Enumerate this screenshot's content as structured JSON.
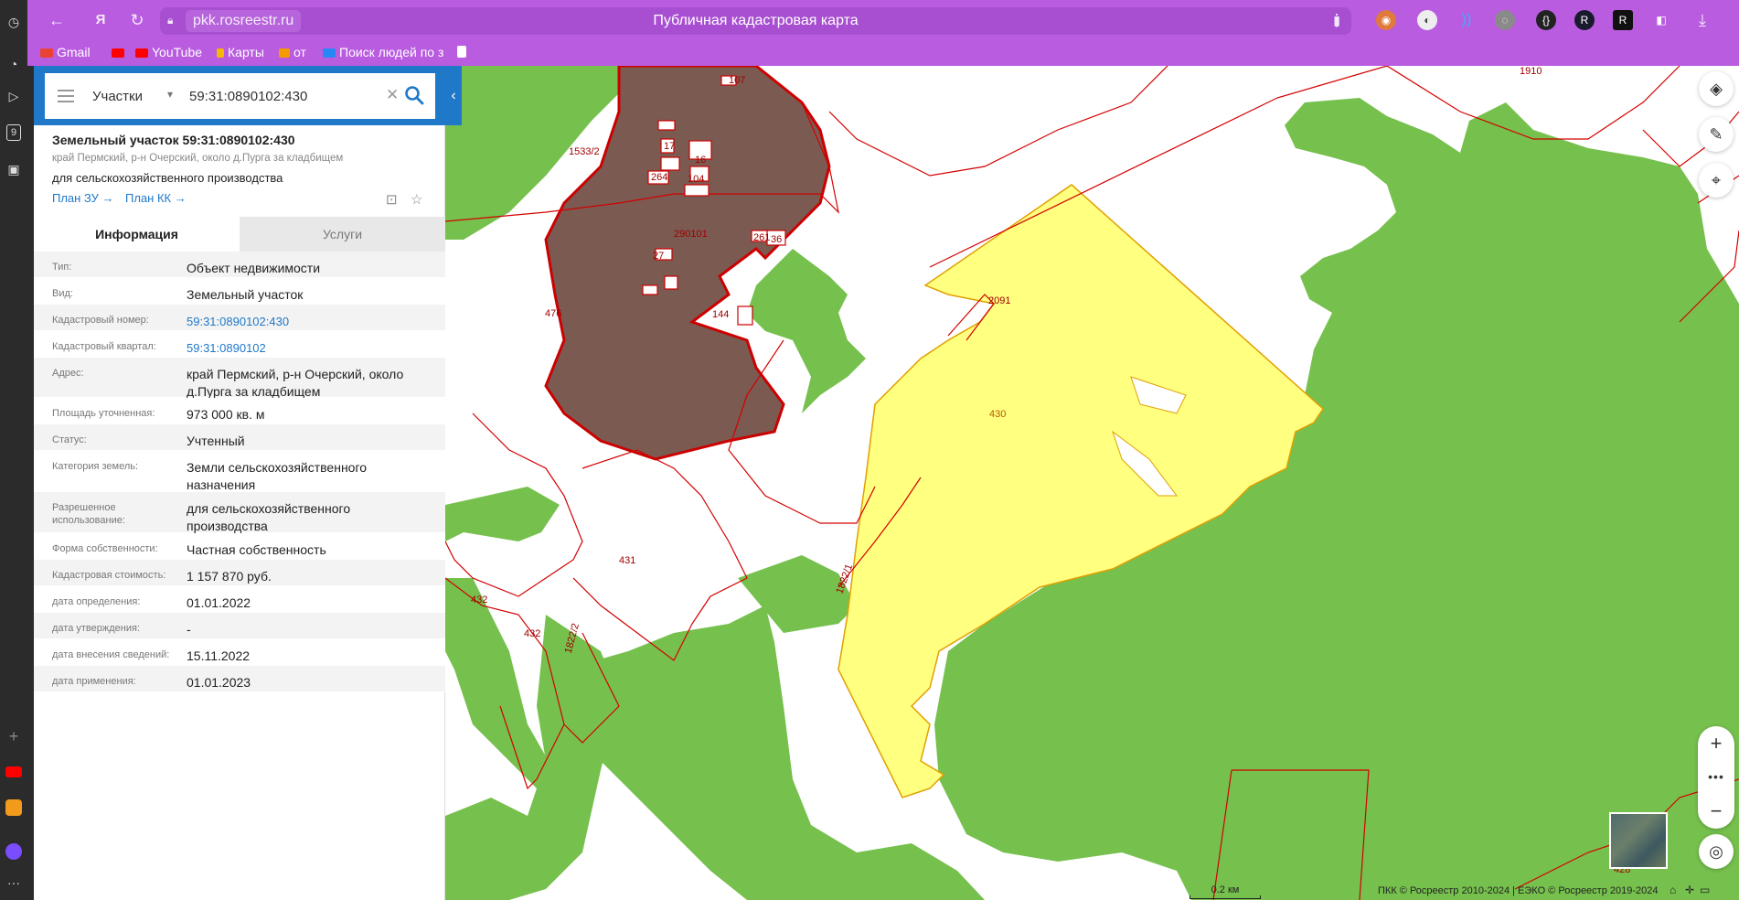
{
  "browser": {
    "url_domain": "pkk.rosreestr.ru",
    "page_title": "Публичная кадастровая карта",
    "bookmarks": [
      {
        "label": "Gmail",
        "color": "#ea4335"
      },
      {
        "label": "YouTube",
        "color": "#ff0000"
      },
      {
        "label": "Карты",
        "color": "#f5b800"
      },
      {
        "label": "от",
        "color": "#f59b00"
      },
      {
        "label": "Поиск людей по з",
        "color": "#2787f5"
      }
    ],
    "rail_badge": "9"
  },
  "search": {
    "type_label": "Участки",
    "query": "59:31:0890102:430"
  },
  "object": {
    "title": "Земельный участок 59:31:0890102:430",
    "address_short": "край Пермский, р-н Очерский, около д.Пурга за кладбищем",
    "use": "для сельскохозяйственного производства",
    "plan_zu": "План ЗУ →",
    "plan_kk": "План КК →"
  },
  "tabs": {
    "info": "Информация",
    "services": "Услуги"
  },
  "rows": [
    {
      "key": "Тип:",
      "value": "Объект недвижимости",
      "link": false,
      "h": 29
    },
    {
      "key": "Вид:",
      "value": "Земельный участок",
      "link": false,
      "h": 29
    },
    {
      "key": "Кадастровый номер:",
      "value": "59:31:0890102:430",
      "link": true,
      "h": 29
    },
    {
      "key": "Кадастровый квартал:",
      "value": "59:31:0890102",
      "link": true,
      "h": 29
    },
    {
      "key": "Адрес:",
      "value": "край Пермский, р-н Очерский, около д.Пурга за кладбищем",
      "link": false,
      "h": 44
    },
    {
      "key": "Площадь уточненная:",
      "value": "973 000 кв. м",
      "link": false,
      "h": 29
    },
    {
      "key": "Статус:",
      "value": "Учтенный",
      "link": false,
      "h": 29
    },
    {
      "key": "Категория земель:",
      "value": "Земли сельскохозяйственного назначения",
      "link": false,
      "h": 45
    },
    {
      "key": "Разрешенное использование:",
      "value": "для сельскохозяйственного производства",
      "link": false,
      "h": 45
    },
    {
      "key": "Форма собственности:",
      "value": "Частная собственность",
      "link": false,
      "h": 29
    },
    {
      "key": "Кадастровая стоимость:",
      "value": "1 157 870 руб.",
      "link": false,
      "h": 29
    },
    {
      "key": "дата определения:",
      "value": "01.01.2022",
      "link": false,
      "h": 29
    },
    {
      "key": "дата утверждения:",
      "value": "-",
      "link": false,
      "h": 29
    },
    {
      "key": "дата внесения сведений:",
      "value": "15.11.2022",
      "link": false,
      "h": 29
    },
    {
      "key": "дата применения:",
      "value": "01.01.2023",
      "link": false,
      "h": 29
    }
  ],
  "map": {
    "labels": [
      "1910",
      "107",
      "1533/2",
      "17",
      "16",
      "264",
      "104",
      "290101",
      "261",
      "36",
      "27",
      "476",
      "144",
      "2091",
      "430",
      "431",
      "432",
      "432",
      "1822/1",
      "1822/2",
      "428"
    ],
    "scale": "0.2 км",
    "copyright": "ПКК © Росреестр 2010-2024 | ЕЭКО © Росреестр 2019-2024",
    "colors": {
      "forest": "#76c04d",
      "selected": "#ffff80",
      "parcel_border": "#d40000",
      "settlement": "#7b5a52"
    }
  }
}
